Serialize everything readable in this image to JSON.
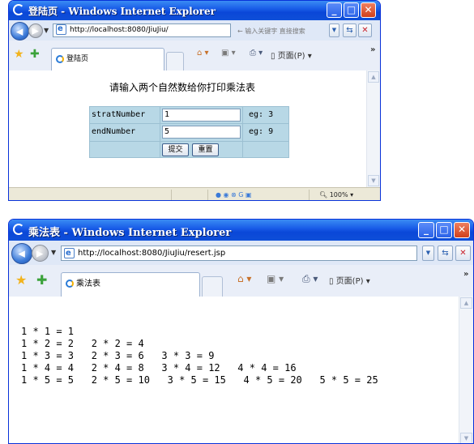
{
  "top": {
    "title": "登陆页 - Windows Internet Explorer",
    "url": "http://localhost:8080/JiuJiu/",
    "search_placeholder": "输入关键字 直接搜索",
    "tab_label": "登陆页",
    "page_menu": "页面(P)",
    "zoom": "100%",
    "form": {
      "heading": "请输入两个自然数给你打印乘法表",
      "start_label": "stratNumber",
      "start_value": "1",
      "start_hint": "eg: 3",
      "end_label": "endNumber",
      "end_value": "5",
      "end_hint": "eg: 9",
      "submit_label": "提交",
      "reset_label": "重置"
    }
  },
  "bottom": {
    "title": "乘法表 - Windows Internet Explorer",
    "url": "http://localhost:8080/JiuJiu/resert.jsp",
    "tab_label": "乘法表",
    "page_menu": "页面(P)",
    "rows": [
      "1 * 1 = 1",
      "1 * 2 = 2   2 * 2 = 4",
      "1 * 3 = 3   2 * 3 = 6   3 * 3 = 9",
      "1 * 4 = 4   2 * 4 = 8   3 * 4 = 12   4 * 4 = 16",
      "1 * 5 = 5   2 * 5 = 10   3 * 5 = 15   4 * 5 = 20   5 * 5 = 25"
    ]
  },
  "icons": {
    "back": "back-arrow-icon",
    "forward": "forward-arrow-icon",
    "refresh": "refresh-icon",
    "stop": "stop-icon",
    "favorites": "favorites-star-icon",
    "home": "home-icon",
    "print": "print-icon",
    "feeds": "feeds-icon",
    "page": "page-icon"
  },
  "colors": {
    "titlebar": "#0a47d8",
    "form_bg": "#b8d8e6",
    "addressbar": "#dfe8f7",
    "statusbar": "#ece9d8"
  }
}
